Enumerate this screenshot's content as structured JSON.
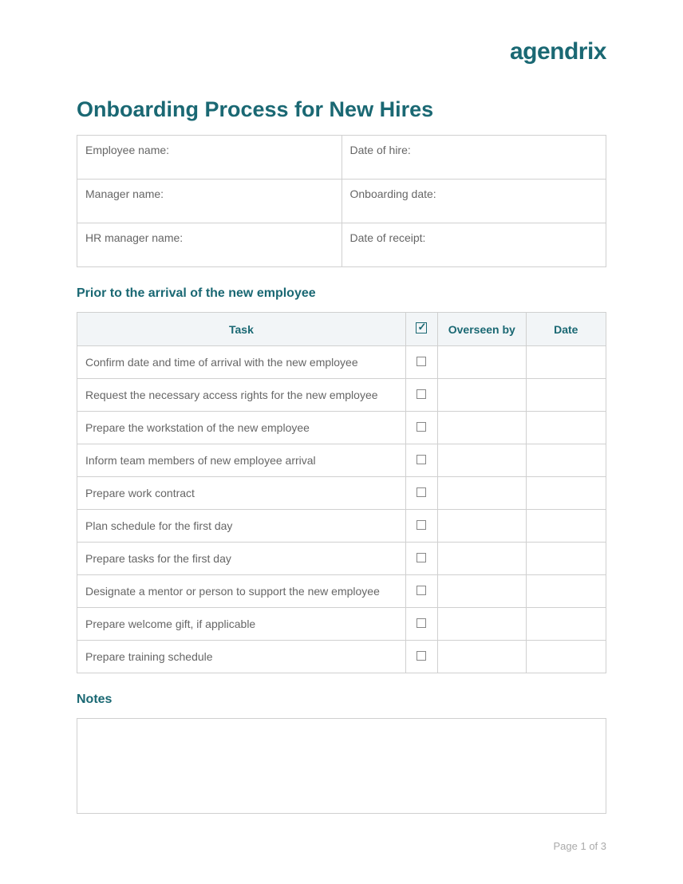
{
  "logo": "agendrix",
  "title": "Onboarding Process for New Hires",
  "info": {
    "employee_name_label": "Employee name:",
    "date_of_hire_label": "Date of hire:",
    "manager_name_label": "Manager name:",
    "onboarding_date_label": "Onboarding date:",
    "hr_manager_name_label": "HR manager name:",
    "date_of_receipt_label": "Date of receipt:"
  },
  "section1_title": "Prior to the arrival of the new employee",
  "table_headers": {
    "task": "Task",
    "overseen_by": "Overseen by",
    "date": "Date"
  },
  "tasks": [
    "Confirm date and time of arrival with the new employee",
    "Request the necessary access rights for the new employee",
    "Prepare the workstation of the new employee",
    "Inform team members of new employee arrival",
    "Prepare work contract",
    "Plan schedule for the first day",
    "Prepare tasks for the first day",
    "Designate a mentor or person to support the new employee",
    "Prepare welcome gift, if applicable",
    "Prepare training schedule"
  ],
  "notes_title": "Notes",
  "footer": "Page 1 of 3"
}
